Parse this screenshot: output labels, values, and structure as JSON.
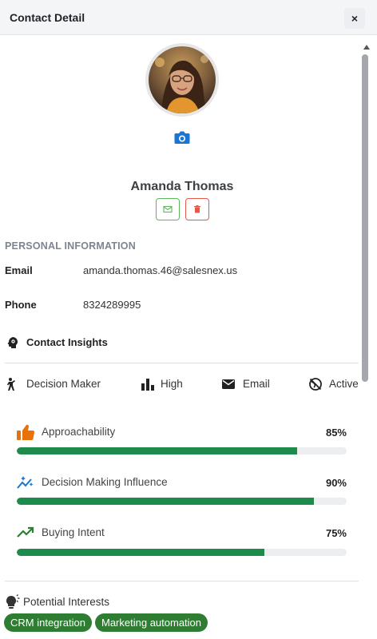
{
  "header": {
    "title": "Contact Detail",
    "close_label": "×"
  },
  "contact": {
    "name": "Amanda Thomas"
  },
  "personal_info": {
    "section_title": "PERSONAL INFORMATION",
    "fields": [
      {
        "label": "Email",
        "value": "amanda.thomas.46@salesnex.us"
      },
      {
        "label": "Phone",
        "value": "8324289995"
      }
    ]
  },
  "insights": {
    "title": "Contact Insights",
    "chips": [
      {
        "icon": "decision-maker-icon",
        "label": "Decision Maker"
      },
      {
        "icon": "bar-chart-icon",
        "label": "High"
      },
      {
        "icon": "email-icon",
        "label": "Email"
      },
      {
        "icon": "globe-off-icon",
        "label": "Active"
      }
    ],
    "metrics": [
      {
        "icon": "thumbs-up-icon",
        "label": "Approachability",
        "percent_label": "85%",
        "value": 0.85
      },
      {
        "icon": "sparkle-trend-icon",
        "label": "Decision Making Influence",
        "percent_label": "90%",
        "value": 0.9
      },
      {
        "icon": "trending-up-icon",
        "label": "Buying Intent",
        "percent_label": "75%",
        "value": 0.75
      }
    ]
  },
  "interests": {
    "title": "Potential Interests",
    "tags": [
      "CRM integration",
      "Marketing automation"
    ]
  },
  "colors": {
    "accent_blue": "#1976d2",
    "progress_green": "#1e8a4c",
    "tag_green": "#2e7d32",
    "thumb_orange": "#e8710a",
    "delete_red": "#e05a45",
    "mail_green": "#5cb85c"
  }
}
